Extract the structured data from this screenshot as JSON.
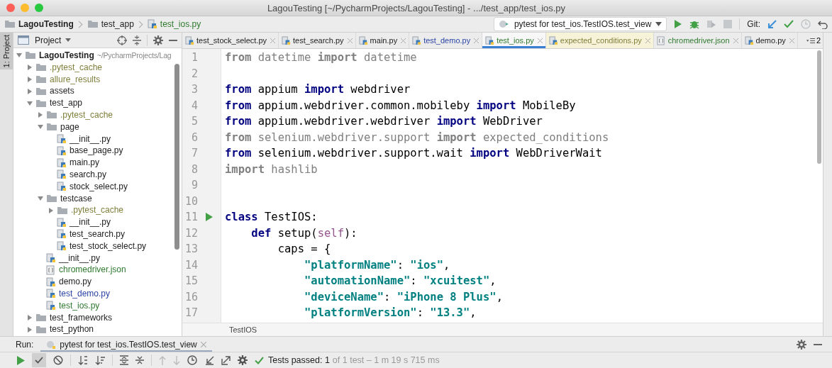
{
  "window": {
    "title": "LagouTesting [~/PycharmProjects/LagouTesting] - .../test_app/test_ios.py"
  },
  "breadcrumbs": [
    {
      "label": "LagouTesting",
      "kind": "root"
    },
    {
      "label": "test_app",
      "kind": "folder"
    },
    {
      "label": "test_ios.py",
      "kind": "file"
    }
  ],
  "run_config": {
    "label": "pytest for test_ios.TestIOS.test_view"
  },
  "git": {
    "label": "Git:"
  },
  "tool_stripe": {
    "label": "1: Project"
  },
  "project_panel": {
    "title": "Project",
    "tree": [
      {
        "label": "LagouTesting",
        "hint": "~/PycharmProjects/Lag",
        "kind": "folder",
        "expanded": true,
        "color": "#222222",
        "children": [
          {
            "label": ".pytest_cache",
            "kind": "folder",
            "expanded": false,
            "color": "#7f7f3c"
          },
          {
            "label": "allure_results",
            "kind": "folder",
            "expanded": false,
            "color": "#7f7f3c"
          },
          {
            "label": "assets",
            "kind": "folder",
            "expanded": false,
            "color": "#222222"
          },
          {
            "label": "test_app",
            "kind": "folder",
            "expanded": true,
            "color": "#222222",
            "children": [
              {
                "label": ".pytest_cache",
                "kind": "folder",
                "expanded": false,
                "color": "#7f7f3c"
              },
              {
                "label": "page",
                "kind": "folder",
                "expanded": true,
                "color": "#222222",
                "children": [
                  {
                    "label": "__init__.py",
                    "kind": "py",
                    "color": "#222222"
                  },
                  {
                    "label": "base_page.py",
                    "kind": "py",
                    "color": "#222222"
                  },
                  {
                    "label": "main.py",
                    "kind": "py",
                    "color": "#222222"
                  },
                  {
                    "label": "search.py",
                    "kind": "py",
                    "color": "#222222"
                  },
                  {
                    "label": "stock_select.py",
                    "kind": "py",
                    "color": "#222222"
                  }
                ]
              },
              {
                "label": "testcase",
                "kind": "folder",
                "expanded": true,
                "color": "#222222",
                "children": [
                  {
                    "label": ".pytest_cache",
                    "kind": "folder",
                    "expanded": false,
                    "color": "#7f7f3c"
                  },
                  {
                    "label": "__init__.py",
                    "kind": "py",
                    "color": "#222222"
                  },
                  {
                    "label": "test_search.py",
                    "kind": "py",
                    "color": "#222222"
                  },
                  {
                    "label": "test_stock_select.py",
                    "kind": "py",
                    "color": "#222222"
                  }
                ]
              },
              {
                "label": "__init__.py",
                "kind": "py",
                "color": "#222222"
              },
              {
                "label": "chromedriver.json",
                "kind": "json",
                "color": "#2f7a2f"
              },
              {
                "label": "demo.py",
                "kind": "py",
                "color": "#222222"
              },
              {
                "label": "test_demo.py",
                "kind": "py",
                "color": "#2b44a6"
              },
              {
                "label": "test_ios.py",
                "kind": "py",
                "color": "#2f7a2f"
              }
            ]
          },
          {
            "label": "test_frameworks",
            "kind": "folder",
            "expanded": false,
            "color": "#222222"
          },
          {
            "label": "test_python",
            "kind": "folder",
            "expanded": false,
            "color": "#222222"
          }
        ]
      }
    ]
  },
  "tabs": [
    {
      "label": "test_stock_select.py",
      "kind": "py",
      "color": "#222222",
      "highlighted": false,
      "selected": false
    },
    {
      "label": "test_search.py",
      "kind": "py",
      "color": "#222222",
      "highlighted": false,
      "selected": false
    },
    {
      "label": "main.py",
      "kind": "py",
      "color": "#222222",
      "highlighted": false,
      "selected": false
    },
    {
      "label": "test_demo.py",
      "kind": "py",
      "color": "#2b44a6",
      "highlighted": false,
      "selected": false
    },
    {
      "label": "test_ios.py",
      "kind": "py",
      "color": "#2f7a2f",
      "highlighted": false,
      "selected": true
    },
    {
      "label": "expected_conditions.py",
      "kind": "py",
      "color": "#7f7f3c",
      "highlighted": true,
      "selected": false
    },
    {
      "label": "chromedriver.json",
      "kind": "json",
      "color": "#2f7a2f",
      "highlighted": false,
      "selected": false
    },
    {
      "label": "demo.py",
      "kind": "py",
      "color": "#222222",
      "highlighted": false,
      "selected": false
    }
  ],
  "tabs_overflow": {
    "count": "2"
  },
  "editor": {
    "lines": [
      {
        "number": "1",
        "tokens": [
          {
            "kind": "dimkw",
            "text": "from"
          },
          {
            "kind": "dim",
            "text": " datetime "
          },
          {
            "kind": "dimkw",
            "text": "import"
          },
          {
            "kind": "dim",
            "text": " datetime"
          }
        ]
      },
      {
        "number": "2"
      },
      {
        "number": "3",
        "tokens": [
          {
            "kind": "kw",
            "text": "from"
          },
          {
            "kind": "id",
            "text": " appium "
          },
          {
            "kind": "kw",
            "text": "import"
          },
          {
            "kind": "id",
            "text": " webdriver"
          }
        ]
      },
      {
        "number": "4",
        "tokens": [
          {
            "kind": "kw",
            "text": "from"
          },
          {
            "kind": "id",
            "text": " appium.webdriver.common.mobileby "
          },
          {
            "kind": "kw",
            "text": "import"
          },
          {
            "kind": "id",
            "text": " MobileBy"
          }
        ]
      },
      {
        "number": "5",
        "tokens": [
          {
            "kind": "kw",
            "text": "from"
          },
          {
            "kind": "id",
            "text": " appium.webdriver.webdriver "
          },
          {
            "kind": "kw",
            "text": "import"
          },
          {
            "kind": "id",
            "text": " WebDriver"
          }
        ]
      },
      {
        "number": "6",
        "tokens": [
          {
            "kind": "dimkw",
            "text": "from"
          },
          {
            "kind": "dim",
            "text": " selenium.webdriver.support "
          },
          {
            "kind": "dimkw",
            "text": "import"
          },
          {
            "kind": "dim",
            "text": " expected_conditions"
          }
        ]
      },
      {
        "number": "7",
        "tokens": [
          {
            "kind": "kw",
            "text": "from"
          },
          {
            "kind": "id",
            "text": " selenium.webdriver.support.wait "
          },
          {
            "kind": "kw",
            "text": "import"
          },
          {
            "kind": "id",
            "text": " WebDriverWait"
          }
        ]
      },
      {
        "number": "8",
        "tokens": [
          {
            "kind": "dimkw",
            "text": "import"
          },
          {
            "kind": "dim",
            "text": " hashlib"
          }
        ]
      },
      {
        "number": "9"
      },
      {
        "number": "10"
      },
      {
        "number": "11",
        "run": true,
        "tokens": [
          {
            "kind": "kw",
            "text": "class"
          },
          {
            "kind": "id",
            "text": " TestIOS:"
          }
        ]
      },
      {
        "number": "12",
        "tokens": [
          {
            "kind": "kw",
            "text": "    def"
          },
          {
            "kind": "id",
            "text": " setup("
          },
          {
            "kind": "self",
            "text": "self"
          },
          {
            "kind": "id",
            "text": "):"
          }
        ]
      },
      {
        "number": "13",
        "tokens": [
          {
            "kind": "id",
            "text": "        caps = {"
          }
        ]
      },
      {
        "number": "14",
        "tokens": [
          {
            "kind": "str",
            "text": "            \"platformName\""
          },
          {
            "kind": "id",
            "text": ": "
          },
          {
            "kind": "str",
            "text": "\"ios\""
          },
          {
            "kind": "id",
            "text": ","
          }
        ]
      },
      {
        "number": "15",
        "tokens": [
          {
            "kind": "str",
            "text": "            \"automationName\""
          },
          {
            "kind": "id",
            "text": ": "
          },
          {
            "kind": "str",
            "text": "\"xcuitest\""
          },
          {
            "kind": "id",
            "text": ","
          }
        ]
      },
      {
        "number": "16",
        "tokens": [
          {
            "kind": "str",
            "text": "            \"deviceName\""
          },
          {
            "kind": "id",
            "text": ": "
          },
          {
            "kind": "str",
            "text": "\"iPhone 8 Plus\""
          },
          {
            "kind": "id",
            "text": ","
          }
        ]
      },
      {
        "number": "17",
        "tokens": [
          {
            "kind": "str",
            "text": "            \"platformVersion\""
          },
          {
            "kind": "id",
            "text": ": "
          },
          {
            "kind": "str",
            "text": "\"13.3\""
          },
          {
            "kind": "id",
            "text": ","
          }
        ]
      }
    ],
    "breadcrumb": "TestIOS"
  },
  "run_panel": {
    "label": "Run:",
    "tab": {
      "label": "pytest for test_ios.TestIOS.test_view",
      "selected": true
    },
    "status": {
      "passed": "Tests passed: 1",
      "detail": "of 1 test – 1 m 19 s 715 ms"
    }
  }
}
